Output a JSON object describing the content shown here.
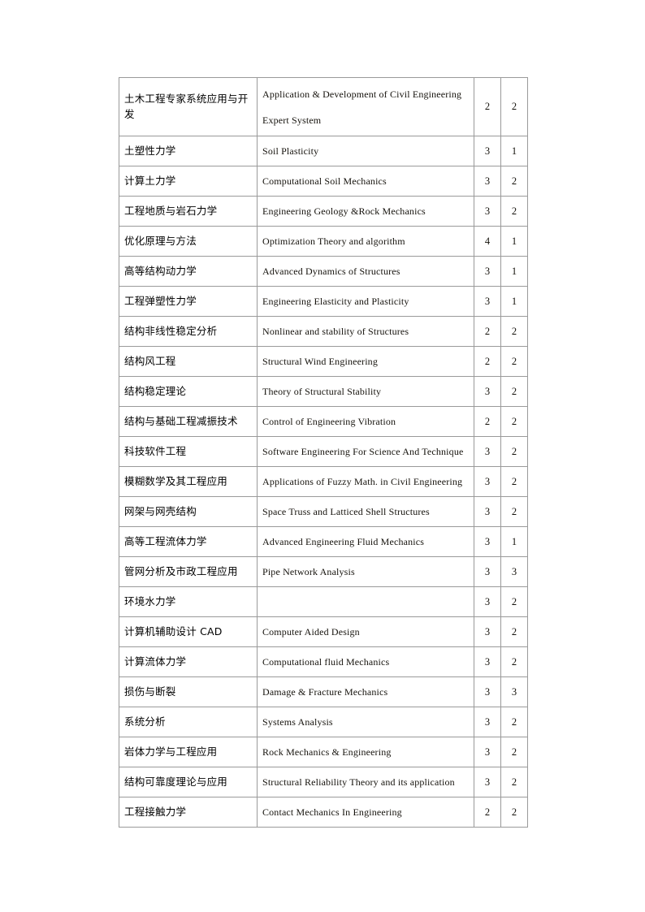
{
  "document": {
    "type": "course-catalog-table",
    "column_count": 4,
    "row_count": 24,
    "border_color": "#9a9a9a",
    "background_color": "#ffffff",
    "text_color": "#15120c"
  },
  "table": {
    "rows": [
      {
        "cn": "土木工程专家系统应用与开发",
        "en_line1": "Application & Development of Civil Engineering",
        "en_line2": "Expert System",
        "a": "2",
        "b": "2",
        "tall": true
      },
      {
        "cn": "土塑性力学",
        "en_line1": "Soil Plasticity",
        "en_line2": "",
        "a": "3",
        "b": "1",
        "tall": false
      },
      {
        "cn": "计算土力学",
        "en_line1": "Computational Soil Mechanics",
        "en_line2": "",
        "a": "3",
        "b": "2",
        "tall": false
      },
      {
        "cn": "工程地质与岩石力学",
        "en_line1": "Engineering  Geology &Rock Mechanics",
        "en_line2": "",
        "a": "3",
        "b": "2",
        "tall": false
      },
      {
        "cn": "优化原理与方法",
        "en_line1": "Optimization  Theory and algorithm",
        "en_line2": "",
        "a": "4",
        "b": "1",
        "tall": false
      },
      {
        "cn": "高等结构动力学",
        "en_line1": "Advanced Dynamics of Structures",
        "en_line2": "",
        "a": "3",
        "b": "1",
        "tall": false
      },
      {
        "cn": "工程弹塑性力学",
        "en_line1": "Engineering  Elasticity and Plasticity",
        "en_line2": "",
        "a": "3",
        "b": "1",
        "tall": false
      },
      {
        "cn": "结构非线性稳定分析",
        "en_line1": "Nonlinear and stability of Structures",
        "en_line2": "",
        "a": "2",
        "b": "2",
        "tall": false
      },
      {
        "cn": "结构风工程",
        "en_line1": "Structural Wind Engineering",
        "en_line2": "",
        "a": "2",
        "b": "2",
        "tall": false
      },
      {
        "cn": "结构稳定理论",
        "en_line1": "Theory of Structural Stability",
        "en_line2": "",
        "a": "3",
        "b": "2",
        "tall": false
      },
      {
        "cn": "结构与基础工程减振技术",
        "en_line1": "Control of Engineering  Vibration",
        "en_line2": "",
        "a": "2",
        "b": "2",
        "tall": false
      },
      {
        "cn": "科技软件工程",
        "en_line1": "Software Engineering  For Science And Technique",
        "en_line2": "",
        "a": "3",
        "b": "2",
        "tall": false
      },
      {
        "cn": "模糊数学及其工程应用",
        "en_line1": "Applications of Fuzzy Math. in Civil Engineering",
        "en_line2": "",
        "a": "3",
        "b": "2",
        "tall": false
      },
      {
        "cn": "网架与网壳结构",
        "en_line1": "Space Truss and Latticed Shell Structures",
        "en_line2": "",
        "a": "3",
        "b": "2",
        "tall": false
      },
      {
        "cn": "高等工程流体力学",
        "en_line1": "Advanced Engineering Fluid Mechanics",
        "en_line2": "",
        "a": "3",
        "b": "1",
        "tall": false
      },
      {
        "cn": "管网分析及市政工程应用",
        "en_line1": "Pipe Network Analysis",
        "en_line2": "",
        "a": "3",
        "b": "3",
        "tall": false
      },
      {
        "cn": "环境水力学",
        "en_line1": "",
        "en_line2": "",
        "a": "3",
        "b": "2",
        "tall": false
      },
      {
        "cn": "计算机辅助设计 CAD",
        "en_line1": "Computer Aided Design",
        "en_line2": "",
        "a": "3",
        "b": "2",
        "tall": false
      },
      {
        "cn": "计算流体力学",
        "en_line1": "Computational  fluid Mechanics",
        "en_line2": "",
        "a": "3",
        "b": "2",
        "tall": false
      },
      {
        "cn": "损伤与断裂",
        "en_line1": "Damage & Fracture Mechanics",
        "en_line2": "",
        "a": "3",
        "b": "3",
        "tall": false
      },
      {
        "cn": "系统分析",
        "en_line1": "Systems Analysis",
        "en_line2": "",
        "a": "3",
        "b": "2",
        "tall": false
      },
      {
        "cn": "岩体力学与工程应用",
        "en_line1": "Rock Mechanics & Engineering",
        "en_line2": "",
        "a": "3",
        "b": "2",
        "tall": false
      },
      {
        "cn": "结构可靠度理论与应用",
        "en_line1": "Structural Reliability  Theory and its application",
        "en_line2": "",
        "a": "3",
        "b": "2",
        "tall": false
      },
      {
        "cn": "工程接触力学",
        "en_line1": "Contact Mechanics In Engineering",
        "en_line2": "",
        "a": "2",
        "b": "2",
        "tall": false
      }
    ]
  }
}
